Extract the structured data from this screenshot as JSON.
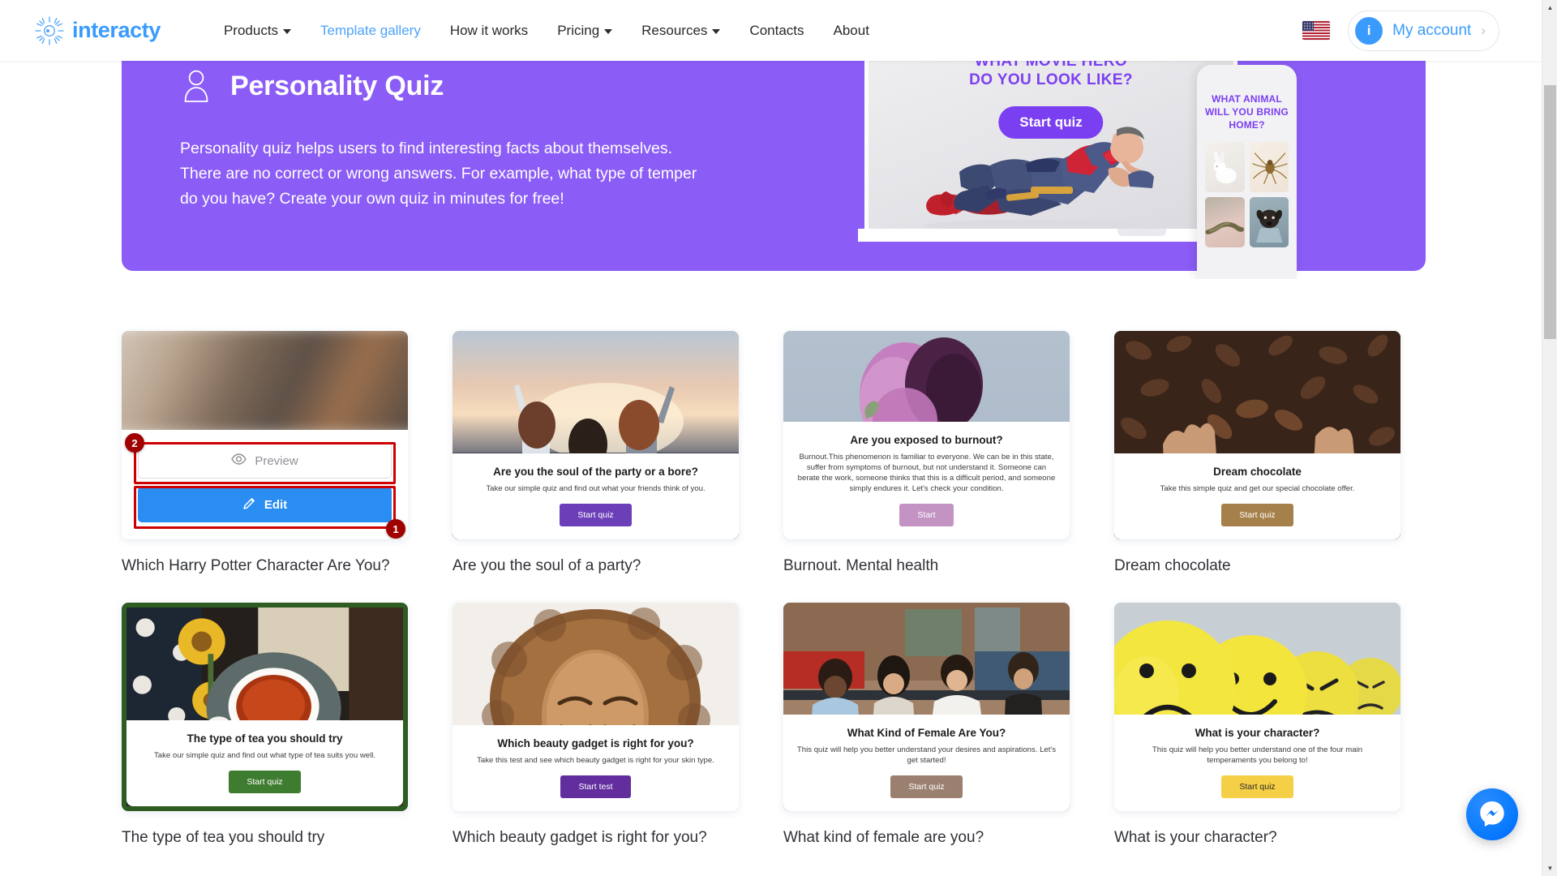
{
  "header": {
    "logo_text": "interacty",
    "logo_icon": "sun-burst-icon",
    "nav": [
      {
        "label": "Products",
        "has_caret": true,
        "active": false
      },
      {
        "label": "Template gallery",
        "has_caret": false,
        "active": true
      },
      {
        "label": "How it works",
        "has_caret": false,
        "active": false
      },
      {
        "label": "Pricing",
        "has_caret": true,
        "active": false
      },
      {
        "label": "Resources",
        "has_caret": true,
        "active": false
      },
      {
        "label": "Contacts",
        "has_caret": false,
        "active": false
      },
      {
        "label": "About",
        "has_caret": false,
        "active": false
      }
    ],
    "language_flag": "us-flag-icon",
    "account": {
      "avatar_initial": "i",
      "label": "My account",
      "chevron": "›"
    },
    "accent_color": "#3a9bfc"
  },
  "banner": {
    "icon": "person-icon",
    "title": "Personality Quiz",
    "description": "Personality quiz helps users to find interesting facts about themselves. There are no correct or wrong answers. For example, what type of temper do you have? Create your own quiz in minutes for free!",
    "background_color": "#8b5cf6",
    "laptop_preview": {
      "headline_line1": "WHAT MOVIE HERO",
      "headline_line2": "DO YOU LOOK LIKE?",
      "button_label": "Start quiz",
      "accent_color": "#7b3ff2"
    },
    "phone_preview": {
      "headline": "WHAT ANIMAL WILL YOU BRING HOME?",
      "accent_color": "#7b3ff2",
      "options": [
        "rabbit-photo",
        "spider-photo",
        "snake-photo",
        "dog-photo"
      ]
    }
  },
  "annotations": {
    "highlight_color": "#cc0000",
    "badge_color": "#a00000",
    "markers": [
      {
        "number": "1",
        "target": "edit-button"
      },
      {
        "number": "2",
        "target": "preview-button"
      }
    ]
  },
  "hover_card": {
    "preview_label": "Preview",
    "preview_icon": "eye-icon",
    "edit_label": "Edit",
    "edit_icon": "pencil-icon",
    "edit_color": "#2a8df2"
  },
  "cards": [
    {
      "title": "Which Harry Potter Character Are You?",
      "hovered": true,
      "image": "harry-potter-blurred-photo"
    },
    {
      "title": "Are you the soul of a party?",
      "hovered": false,
      "image": "three-friends-sunset-photo",
      "overlay": {
        "heading": "Are you the soul of the party or a bore?",
        "description": "Take our simple quiz and find out what your friends think of you.",
        "button_label": "Start quiz",
        "button_color": "#6b3fb8"
      }
    },
    {
      "title": "Burnout. Mental health",
      "hovered": false,
      "image": "wilted-purple-rose-photo",
      "overlay": {
        "heading": "Are you exposed to burnout?",
        "description": "Burnout.This phenomenon is familiar to everyone. We can be in this state, suffer from symptoms of burnout, but not understand it. Someone can berate the work, someone thinks that this is a difficult period, and someone simply endures it. Let's check your condition.",
        "button_label": "Start",
        "button_color": "#c393c3"
      }
    },
    {
      "title": "Dream chocolate",
      "hovered": false,
      "image": "cocoa-beans-hands-photo",
      "overlay": {
        "heading": "Dream chocolate",
        "description": "Take this simple quiz and get our special chocolate offer.",
        "button_label": "Start quiz",
        "button_color": "#a5804a"
      }
    },
    {
      "title": "The type of tea you should try",
      "hovered": false,
      "image": "tea-cup-sunflowers-photo",
      "overlay": {
        "heading": "The type of tea you should try",
        "description": "Take our simple quiz and find out what type of tea suits you well.",
        "button_label": "Start quiz",
        "button_color": "#3e7c30"
      }
    },
    {
      "title": "Which beauty gadget is right for you?",
      "hovered": false,
      "image": "woman-curly-hair-photo",
      "overlay": {
        "heading": "Which beauty gadget is right for you?",
        "description": "Take this test and see which beauty gadget is right for your skin type.",
        "button_label": "Start test",
        "button_color": "#622e9e"
      }
    },
    {
      "title": "What kind of female are you?",
      "hovered": false,
      "image": "four-women-bench-dog-photo",
      "overlay": {
        "heading": "What Kind of Female Are You?",
        "description": "This quiz will help you better understand your desires and aspirations. Let's get started!",
        "button_label": "Start quiz",
        "button_color": "#9b8070"
      }
    },
    {
      "title": "What is your character?",
      "hovered": false,
      "image": "yellow-emoji-balls-photo",
      "overlay": {
        "heading": "What is your character?",
        "description": "This quiz will help you better understand one of the four main temperaments you belong to!",
        "button_label": "Start quiz",
        "button_color": "#f5cf45"
      }
    }
  ],
  "messenger": {
    "icon": "messenger-icon",
    "color": "#0a7cff"
  },
  "scrollbar": {
    "up_arrow": "▲",
    "down_arrow": "▼"
  }
}
